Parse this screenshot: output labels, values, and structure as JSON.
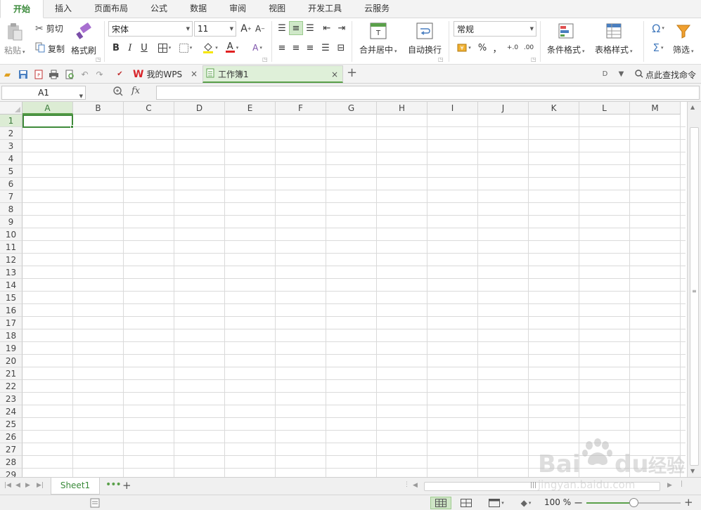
{
  "ribbon_tabs": [
    "开始",
    "插入",
    "页面布局",
    "公式",
    "数据",
    "审阅",
    "视图",
    "开发工具",
    "云服务"
  ],
  "clipboard": {
    "paste": "粘贴",
    "cut": "剪切",
    "copy": "复制",
    "format_painter": "格式刷"
  },
  "font": {
    "name": "宋体",
    "size": "11",
    "bold": "B",
    "italic": "I",
    "underline": "U"
  },
  "alignment": {
    "merge_center": "合并居中",
    "wrap_text": "自动换行"
  },
  "number": {
    "format": "常规",
    "percent": "%",
    "comma": "，"
  },
  "styles": {
    "conditional_format": "条件格式",
    "table_style": "表格样式",
    "filter": "筛选"
  },
  "doc_tabs": [
    {
      "label": "我的WPS"
    },
    {
      "label": "工作簿1"
    }
  ],
  "search_command": "点此查找命令",
  "formula_bar": {
    "name_box": "A1",
    "fx": "fx",
    "value": ""
  },
  "columns": [
    "A",
    "B",
    "C",
    "D",
    "E",
    "F",
    "G",
    "H",
    "I",
    "J",
    "K",
    "L",
    "M"
  ],
  "rows": [
    "1",
    "2",
    "3",
    "4",
    "5",
    "6",
    "7",
    "8",
    "9",
    "10",
    "11",
    "12",
    "13",
    "14",
    "15",
    "16",
    "17",
    "18",
    "19",
    "20",
    "21",
    "22",
    "23",
    "24",
    "25",
    "26",
    "27",
    "28",
    "29"
  ],
  "selected_cell": "A1",
  "sheets": [
    "Sheet1"
  ],
  "status": {
    "zoom": "100 %",
    "zoom_level": 0.5
  },
  "watermark": {
    "text": "Baidu经验",
    "url_text": "jingyan.baidu.com"
  },
  "colors": {
    "accent": "#3a8a3a",
    "active_tab_bg": "#dff0d9",
    "wps_red": "#d8262b"
  }
}
